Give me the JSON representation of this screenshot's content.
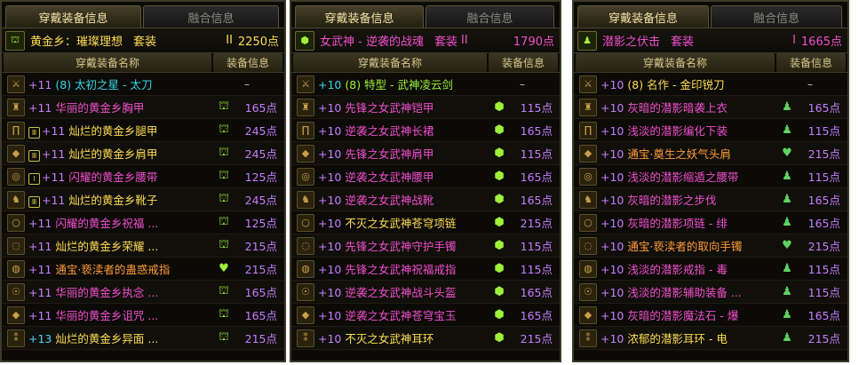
{
  "tabs": {
    "wear": "穿戴装备信息",
    "fusion": "融合信息"
  },
  "columns": {
    "name": "穿戴装备名称",
    "info": "装备信息"
  },
  "colors": {
    "purple": "#c77dff",
    "pink": "#f04fcf",
    "gold": "#ffdd55",
    "cyan": "#35d6e8",
    "orange": "#ff9a3c",
    "green": "#9ef03a",
    "teal": "#46d5ff"
  },
  "panels": [
    {
      "set": {
        "name": "黄金乡：璀璨理想",
        "kw": "套装",
        "level": "II",
        "points": "2250点"
      },
      "weapon": {
        "enh": "+11",
        "rest": "(8) 太初之星 - 太刀",
        "value": "–"
      },
      "items": [
        {
          "enh": "+11",
          "name": "华丽的黄金乡胸甲",
          "pts": "165点",
          "badge": ""
        },
        {
          "enh": "+11",
          "name": "灿烂的黄金乡腿甲",
          "pts": "245点",
          "badge": "Ⅲ"
        },
        {
          "enh": "+11",
          "name": "灿烂的黄金乡肩甲",
          "pts": "245点",
          "badge": "Ⅲ"
        },
        {
          "enh": "+11",
          "name": "闪耀的黄金乡腰带",
          "pts": "125点",
          "badge": "Ⅰ"
        },
        {
          "enh": "+11",
          "name": "灿烂的黄金乡靴子",
          "pts": "245点",
          "badge": "Ⅲ"
        },
        {
          "enh": "+11",
          "name": "闪耀的黄金乡祝福 ...",
          "pts": "125点",
          "badge": ""
        },
        {
          "enh": "+11",
          "name": "灿烂的黄金乡荣耀 ...",
          "pts": "215点",
          "badge": ""
        },
        {
          "enh": "+11",
          "name": "通宝·亵渎者的蛊惑戒指",
          "pts": "215点",
          "badge": ""
        },
        {
          "enh": "+11",
          "name": "华丽的黄金乡执念 ...",
          "pts": "165点",
          "badge": ""
        },
        {
          "enh": "+11",
          "name": "华丽的黄金乡诅咒 ...",
          "pts": "165点",
          "badge": ""
        },
        {
          "enh": "+13",
          "name": "灿烂的黄金乡异面 ...",
          "pts": "215点",
          "badge": ""
        }
      ]
    },
    {
      "set": {
        "name": "女武神 - 逆袭的战魂",
        "kw": "套装",
        "level": "II",
        "points": "1790点"
      },
      "weapon": {
        "enh": "+10",
        "rest": "(8) 特型 - 武神凌云剑",
        "value": "–"
      },
      "items": [
        {
          "enh": "+10",
          "name": "先锋之女武神铠甲",
          "pts": "115点",
          "badge": ""
        },
        {
          "enh": "+10",
          "name": "逆袭之女武神长裙",
          "pts": "165点",
          "badge": ""
        },
        {
          "enh": "+10",
          "name": "先锋之女武神肩甲",
          "pts": "115点",
          "badge": ""
        },
        {
          "enh": "+10",
          "name": "逆袭之女武神腰甲",
          "pts": "165点",
          "badge": ""
        },
        {
          "enh": "+10",
          "name": "逆袭之女武神战靴",
          "pts": "165点",
          "badge": ""
        },
        {
          "enh": "+10",
          "name": "不灭之女武神苍穹项链",
          "pts": "215点",
          "badge": ""
        },
        {
          "enh": "+10",
          "name": "先锋之女武神守护手镯",
          "pts": "115点",
          "badge": ""
        },
        {
          "enh": "+10",
          "name": "先锋之女武神祝福戒指",
          "pts": "115点",
          "badge": ""
        },
        {
          "enh": "+10",
          "name": "逆袭之女武神战斗头盔",
          "pts": "165点",
          "badge": ""
        },
        {
          "enh": "+10",
          "name": "逆袭之女武神苍穹宝玉",
          "pts": "165点",
          "badge": ""
        },
        {
          "enh": "+10",
          "name": "不灭之女武神耳环",
          "pts": "215点",
          "badge": ""
        }
      ]
    },
    {
      "set": {
        "name": "潜影之伏击",
        "kw": "套装",
        "level": "I",
        "points": "1665点"
      },
      "weapon": {
        "enh": "+10",
        "rest": "(8) 名作 - 金印锐刀",
        "value": "–"
      },
      "items": [
        {
          "enh": "+10",
          "name": "灰暗的潜影暗袭上衣",
          "pts": "165点",
          "badge": ""
        },
        {
          "enh": "+10",
          "name": "浅淡的潜影编化下装",
          "pts": "115点",
          "badge": ""
        },
        {
          "enh": "+10",
          "name": "通宝·奠生之妖气头肩",
          "pts": "215点",
          "badge": ""
        },
        {
          "enh": "+10",
          "name": "浅淡的潜影缩遁之腰带",
          "pts": "115点",
          "badge": ""
        },
        {
          "enh": "+10",
          "name": "灰暗的潜影之步伐",
          "pts": "165点",
          "badge": ""
        },
        {
          "enh": "+10",
          "name": "灰暗的潜影项链 - 绯",
          "pts": "165点",
          "badge": ""
        },
        {
          "enh": "+10",
          "name": "通宝·亵渎者的取向手镯",
          "pts": "215点",
          "badge": ""
        },
        {
          "enh": "+10",
          "name": "浅淡的潜影戒指 - 毒",
          "pts": "115点",
          "badge": ""
        },
        {
          "enh": "+10",
          "name": "浅淡的潜影辅助装备 ...",
          "pts": "115点",
          "badge": ""
        },
        {
          "enh": "+10",
          "name": "灰暗的潜影魔法石 - 爆",
          "pts": "165点",
          "badge": ""
        },
        {
          "enh": "+10",
          "name": "浓郁的潜影耳环 - 电",
          "pts": "215点",
          "badge": ""
        }
      ]
    }
  ]
}
